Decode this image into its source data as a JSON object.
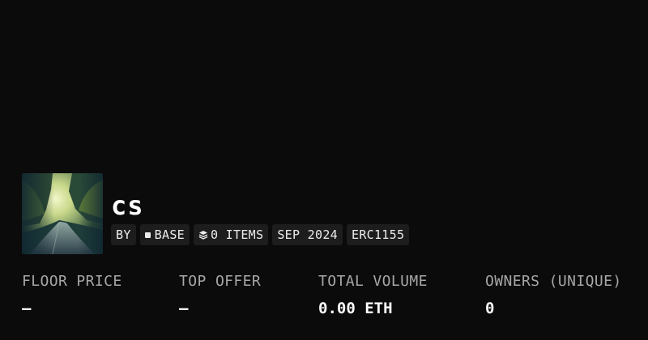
{
  "collection": {
    "title": "cs",
    "tags": {
      "by_label": "BY",
      "chain_label": "BASE",
      "items_label": "0 ITEMS",
      "date_label": "SEP 2024",
      "standard_label": "ERC1155"
    }
  },
  "stats": [
    {
      "label": "FLOOR PRICE",
      "value": "—"
    },
    {
      "label": "TOP OFFER",
      "value": "—"
    },
    {
      "label": "TOTAL VOLUME",
      "value": "0.00 ETH"
    },
    {
      "label": "OWNERS (UNIQUE)",
      "value": "0"
    }
  ],
  "icons": {
    "chain": "square-icon",
    "items": "layers-icon"
  },
  "colors": {
    "background": "#0b0b0b",
    "tag_background": "#1d1d1d",
    "label": "#a7a7a7",
    "text": "#ffffff"
  }
}
